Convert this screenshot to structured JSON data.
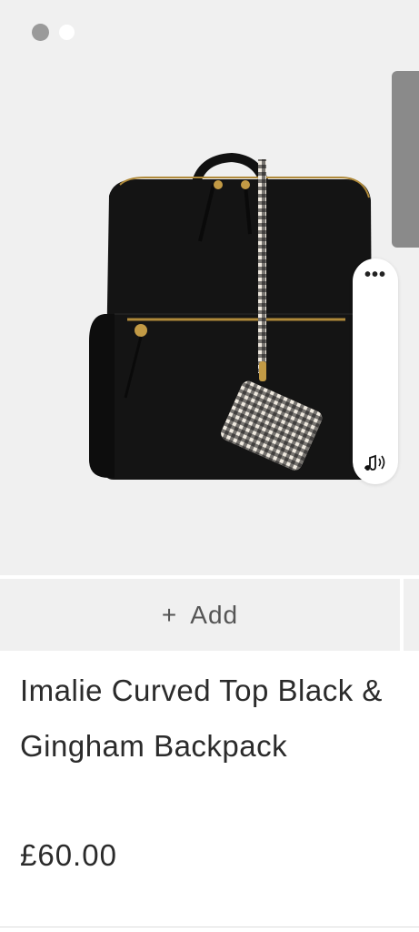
{
  "carousel": {
    "dots": [
      "active",
      "inactive"
    ]
  },
  "widget": {
    "more_label": "•••",
    "audio_icon": "speaker-music-icon"
  },
  "actions": {
    "add_symbol": "+",
    "add_label": "Add"
  },
  "product": {
    "title": "Imalie Curved Top Black & Gingham Backpack",
    "price": "£60.00"
  },
  "colors": {
    "image_bg": "#f0f0f0",
    "add_bg": "#f0f0f0",
    "text": "#2b2b2b"
  }
}
